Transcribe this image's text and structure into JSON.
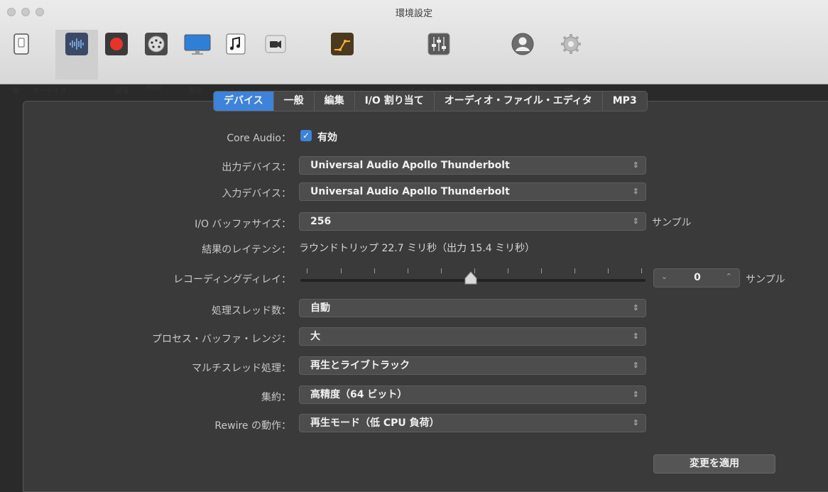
{
  "window": {
    "title": "環境設定"
  },
  "toolbar": {
    "items": [
      {
        "label": "一般",
        "icon": "switch-icon",
        "selected": false
      },
      {
        "label": "オーディオ",
        "icon": "waveform-icon",
        "selected": true
      },
      {
        "label": "録音",
        "icon": "record-icon",
        "selected": false
      },
      {
        "label": "MIDI",
        "icon": "midi-connector-icon",
        "selected": false
      },
      {
        "label": "表示",
        "icon": "display-icon",
        "selected": false
      },
      {
        "label": "スコア",
        "icon": "music-note-icon",
        "selected": false
      },
      {
        "label": "ムービー",
        "icon": "camera-icon",
        "selected": false
      },
      {
        "label": "オートメーション",
        "icon": "automation-curve-icon",
        "selected": false
      },
      {
        "label": "コントロールサーフェス",
        "icon": "mixer-faders-icon",
        "selected": false
      },
      {
        "label": "自分の情報",
        "icon": "user-icon",
        "selected": false
      },
      {
        "label": "詳細",
        "icon": "gear-icon",
        "selected": false
      }
    ]
  },
  "tabs": [
    {
      "label": "デバイス",
      "active": true
    },
    {
      "label": "一般",
      "active": false
    },
    {
      "label": "編集",
      "active": false
    },
    {
      "label": "I/O 割り当て",
      "active": false
    },
    {
      "label": "オーディオ・ファイル・エディタ",
      "active": false
    },
    {
      "label": "MP3",
      "active": false
    }
  ],
  "form": {
    "core_audio_label": "Core Audio：",
    "core_audio_checkbox": "有効",
    "output_device_label": "出力デバイス：",
    "output_device_value": "Universal Audio Apollo Thunderbolt",
    "input_device_label": "入力デバイス：",
    "input_device_value": "Universal Audio Apollo Thunderbolt",
    "buffer_size_label": "I/O バッファサイズ：",
    "buffer_size_value": "256",
    "samples_unit": "サンプル",
    "latency_label": "結果のレイテンシ：",
    "latency_value": "ラウンドトリップ 22.7 ミリ秒（出力 15.4 ミリ秒）",
    "recording_delay_label": "レコーディングディレイ：",
    "recording_delay_value": "0",
    "recording_delay_slider_fraction": 0.5,
    "threads_label": "処理スレッド数：",
    "threads_value": "自動",
    "buffer_range_label": "プロセス・バッファ・レンジ：",
    "buffer_range_value": "大",
    "multithread_label": "マルチスレッド処理：",
    "multithread_value": "再生とライブトラック",
    "summing_label": "集約：",
    "summing_value": "高精度（64 ビット）",
    "rewire_label": "Rewire の動作：",
    "rewire_value": "再生モード（低 CPU 負荷）",
    "apply_button": "変更を適用"
  },
  "colors": {
    "accent": "#3d83d9",
    "record_red": "#e8332a"
  }
}
